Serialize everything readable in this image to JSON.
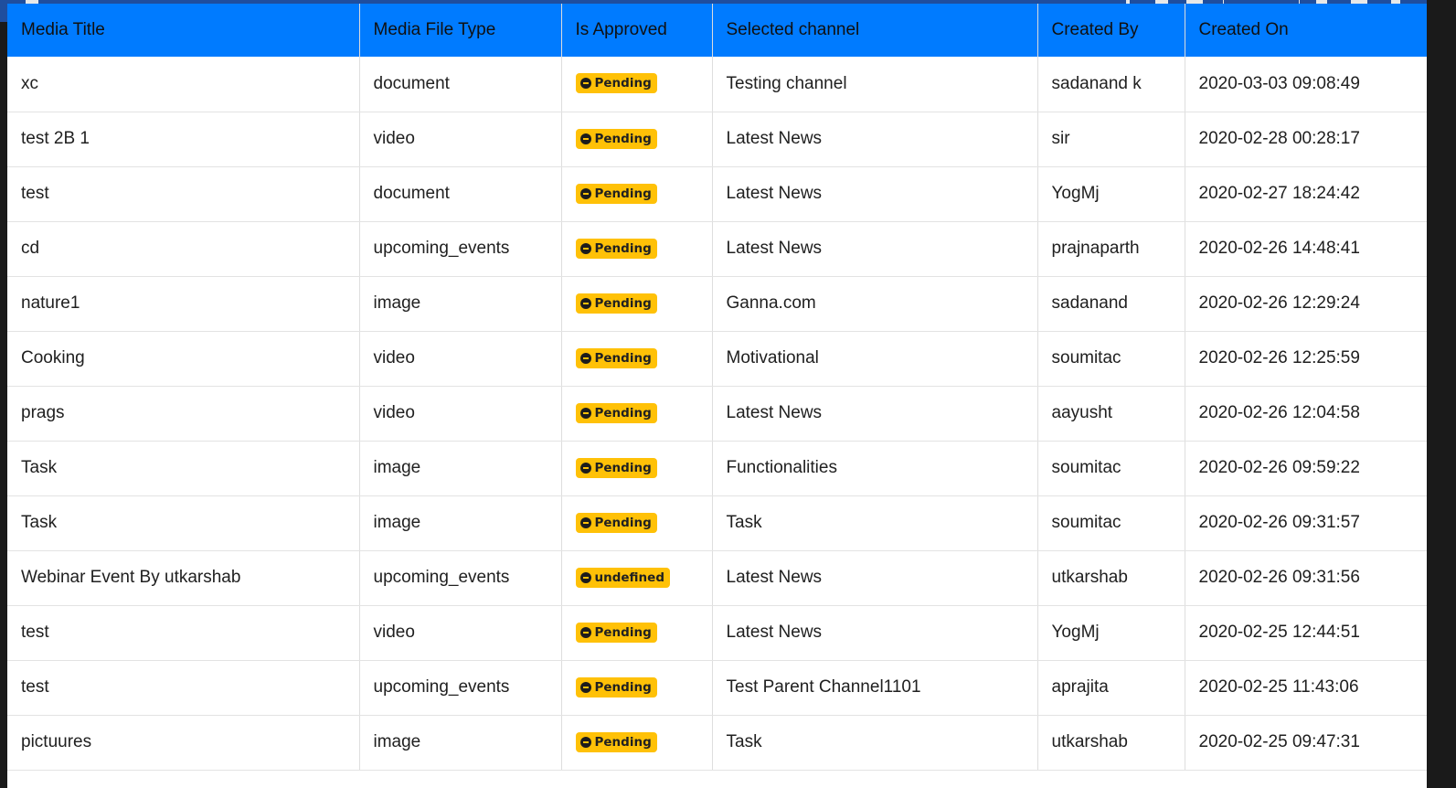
{
  "table": {
    "headers": [
      "Media Title",
      "Media File Type",
      "Is Approved",
      "Selected channel",
      "Created By",
      "Created On"
    ],
    "rows": [
      {
        "title": "xc",
        "type": "document",
        "status": "Pending",
        "channel": "Testing channel",
        "created_by": "sadanand k",
        "created_on": "2020-03-03 09:08:49"
      },
      {
        "title": "test 2B 1",
        "type": "video",
        "status": "Pending",
        "channel": "Latest News",
        "created_by": "sir",
        "created_on": "2020-02-28 00:28:17"
      },
      {
        "title": "test",
        "type": "document",
        "status": "Pending",
        "channel": "Latest News",
        "created_by": "YogMj",
        "created_on": "2020-02-27 18:24:42"
      },
      {
        "title": "cd",
        "type": "upcoming_events",
        "status": "Pending",
        "channel": "Latest News",
        "created_by": "prajnaparth",
        "created_on": "2020-02-26 14:48:41"
      },
      {
        "title": "nature1",
        "type": "image",
        "status": "Pending",
        "channel": "Ganna.com",
        "created_by": "sadanand",
        "created_on": "2020-02-26 12:29:24"
      },
      {
        "title": "Cooking",
        "type": "video",
        "status": "Pending",
        "channel": "Motivational",
        "created_by": "soumitac",
        "created_on": "2020-02-26 12:25:59"
      },
      {
        "title": "prags",
        "type": "video",
        "status": "Pending",
        "channel": "Latest News",
        "created_by": "aayusht",
        "created_on": "2020-02-26 12:04:58"
      },
      {
        "title": "Task",
        "type": "image",
        "status": "Pending",
        "channel": "Functionalities",
        "created_by": "soumitac",
        "created_on": "2020-02-26 09:59:22"
      },
      {
        "title": "Task",
        "type": "image",
        "status": "Pending",
        "channel": "Task",
        "created_by": "soumitac",
        "created_on": "2020-02-26 09:31:57"
      },
      {
        "title": "Webinar Event By utkarshab",
        "type": "upcoming_events",
        "status": "undefined",
        "channel": "Latest News",
        "created_by": "utkarshab",
        "created_on": "2020-02-26 09:31:56"
      },
      {
        "title": "test",
        "type": "video",
        "status": "Pending",
        "channel": "Latest News",
        "created_by": "YogMj",
        "created_on": "2020-02-25 12:44:51"
      },
      {
        "title": "test",
        "type": "upcoming_events",
        "status": "Pending",
        "channel": "Test Parent Channel1101",
        "created_by": "aprajita",
        "created_on": "2020-02-25 11:43:06"
      },
      {
        "title": "pictuures",
        "type": "image",
        "status": "Pending",
        "channel": "Task",
        "created_by": "utkarshab",
        "created_on": "2020-02-25 09:47:31"
      }
    ]
  },
  "colors": {
    "header_bg": "#007bff",
    "badge_bg": "#ffc107"
  },
  "icons": {
    "status": "minus-circle-icon"
  }
}
